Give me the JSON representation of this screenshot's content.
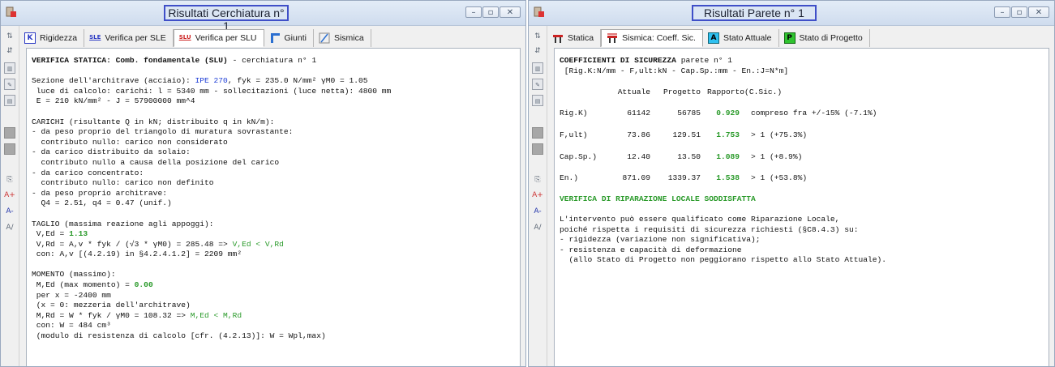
{
  "left": {
    "title": "Risultati Cerchiatura n° 1",
    "tabs": [
      {
        "label": "Rigidezza",
        "icon": "K"
      },
      {
        "label": "Verifica per SLE",
        "icon": "SLE"
      },
      {
        "label": "Verifica per SLU",
        "icon": "SLU"
      },
      {
        "label": "Giunti",
        "icon": "giunti-icon"
      },
      {
        "label": "Sismica",
        "icon": "sismica-icon"
      }
    ],
    "lines": [
      {
        "a": "VERIFICA STATICA: Comb. fondamentale (SLU)",
        "b": " - cerchiatura n° 1"
      },
      {
        "a": "Sezione dell'architrave (acciaio): ",
        "b": "IPE 270",
        "c": ", fyk = 235.0 N/mm² γM0 = 1.05"
      },
      {
        "a": " luce di calcolo: carichi: l = 5340 mm - sollecitazioni (luce netta): 4800 mm"
      },
      {
        "a": " E = 210 kN/mm² - J = 57900000 mm^4"
      },
      {
        "a": "CARICHI (risultante Q in kN; distribuito q in kN/m):"
      },
      {
        "a": "- da peso proprio del triangolo di muratura sovrastante:"
      },
      {
        "a": "  contributo nullo: carico non considerato"
      },
      {
        "a": "- da carico distribuito da solaio:"
      },
      {
        "a": "  contributo nullo a causa della posizione del carico"
      },
      {
        "a": "- da carico concentrato:"
      },
      {
        "a": "  contributo nullo: carico non definito"
      },
      {
        "a": "- da peso proprio architrave:"
      },
      {
        "a": "  Q4 = 2.51, q4 = 0.47 (unif.)"
      },
      {
        "a": "TAGLIO (massima reazione agli appoggi):"
      },
      {
        "a": " V,Ed = ",
        "b": "1.13"
      },
      {
        "a": " V,Rd = A,v * fyk / (√3 * γM0) = 285.48 => ",
        "b": "V,Ed < V,Rd"
      },
      {
        "a": " con: A,v [(4.2.19) in §4.2.4.1.2] = 2209 mm²"
      },
      {
        "a": "MOMENTO (massimo):"
      },
      {
        "a": " M,Ed (max momento) = ",
        "b": "0.00"
      },
      {
        "a": " per x = -2400 mm"
      },
      {
        "a": " (x = 0: mezzeria dell'architrave)"
      },
      {
        "a": " M,Rd = W * fyk / γM0 = 108.32 => ",
        "b": "M,Ed < M,Rd"
      },
      {
        "a": " con: W = 484 cm³"
      },
      {
        "a": " (modulo di resistenza di calcolo [cfr. (4.2.13)]: W = Wpl,max)"
      }
    ]
  },
  "right": {
    "title": "Risultati Parete n° 1",
    "tabs": [
      {
        "label": "Statica",
        "icon": "statica-icon"
      },
      {
        "label": "Sismica: Coeff. Sic.",
        "icon": "sismica-icon"
      },
      {
        "label": "Stato Attuale",
        "icon": "A"
      },
      {
        "label": "Stato di Progetto",
        "icon": "P"
      }
    ],
    "heading": "COEFFICIENTI DI SICUREZZA",
    "heading_suffix": " parete n° 1",
    "units": " [Rig.K:N/mm - F,ult:kN - Cap.Sp.:mm - En.:J=N*m]",
    "table_header": {
      "c2": "Attuale",
      "c3": "Progetto",
      "c4": "Rapporto(C.Sic.)"
    },
    "rows": [
      {
        "name": "Rig.K)",
        "attuale": "61142",
        "progetto": "56785",
        "ratio": "0.929",
        "note": "compreso fra +/-15% (-7.1%)"
      },
      {
        "name": "F,ult)",
        "attuale": "73.86",
        "progetto": "129.51",
        "ratio": "1.753",
        "note": "> 1 (+75.3%)"
      },
      {
        "name": "Cap.Sp.)",
        "attuale": "12.40",
        "progetto": "13.50",
        "ratio": "1.089",
        "note": "> 1 (+8.9%)"
      },
      {
        "name": "En.)",
        "attuale": "871.09",
        "progetto": "1339.37",
        "ratio": "1.538",
        "note": "> 1 (+53.8%)"
      }
    ],
    "verdict": "VERIFICA DI RIPARAZIONE LOCALE SODDISFATTA",
    "text": [
      "L'intervento può essere qualificato come Riparazione Locale,",
      "poiché rispetta i requisiti di sicurezza richiesti (§C8.4.3) su:",
      "- rigidezza (variazione non significativa);",
      "- resistenza e capacità di deformazione",
      "  (allo Stato di Progetto non peggiorano rispetto allo Stato Attuale)."
    ]
  },
  "sidetools": [
    "A+",
    "A-",
    "A/"
  ],
  "colors": {
    "title_border": "#3f4fc8",
    "green": "#2a9a2a",
    "blue": "#1f3fd6"
  }
}
